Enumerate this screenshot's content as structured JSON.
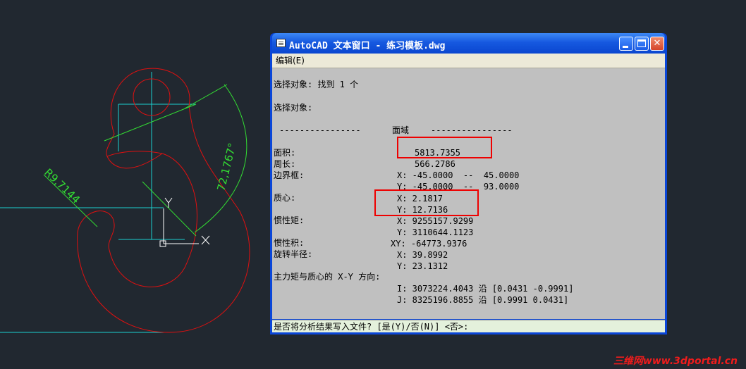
{
  "drawing": {
    "dim_radius": "R9,7144",
    "dim_angle": "72,1767°",
    "ucs_x_label": "X",
    "ucs_y_label": "Y",
    "colors": {
      "background": "#212830",
      "geometry": "#e01010",
      "centerlines": "#1cd0d0",
      "dimensions": "#33dd33",
      "cursor": "#ffffff"
    }
  },
  "window": {
    "title": "AutoCAD 文本窗口 - 练习模板.dwg",
    "min_icon": "minimize-icon",
    "max_icon": "maximize-icon",
    "close_glyph": "✕",
    "menu_edit": "编辑(E)",
    "console": {
      "select_found": "选择对象: 找到 1 个",
      "select_prompt": "选择对象:",
      "divider_left": "----------------",
      "section_title": "面域",
      "divider_right": "----------------",
      "area_label": "面积:",
      "area_value": "5813.7355",
      "perimeter_label": "周长:",
      "perimeter_value": "566.2786",
      "bbox_label": "边界框:",
      "bbox_x": "X: -45.0000  --  45.0000",
      "bbox_y": "Y: -45.0000  --  93.0000",
      "centroid_label": "质心:",
      "centroid_x": "X: 2.1817",
      "centroid_y": "Y: 12.7136",
      "moi_label": "惯性矩:",
      "moi_x": "X: 9255157.9299",
      "moi_y": "Y: 3110644.1123",
      "poi_label": "惯性积:",
      "poi_xy": "XY: -64773.9376",
      "gyr_label": "旋转半径:",
      "gyr_x": "X: 39.8992",
      "gyr_y": "Y: 23.1312",
      "principal_label": "主力矩与质心的 X-Y 方向:",
      "principal_i": "I: 3073224.4043 沿 [0.0431 -0.9991]",
      "principal_j": "J: 8325196.8855 沿 [0.9991 0.0431]"
    },
    "command_line": "是否将分析结果写入文件? [是(Y)/否(N)] <否>:"
  },
  "watermark": "三维网www.3dportal.cn"
}
